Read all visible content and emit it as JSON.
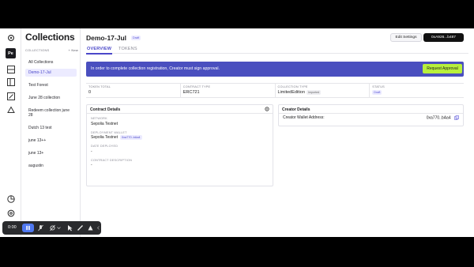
{
  "sidebar": {
    "title": "Collections",
    "section_label": "COLLECTIONS",
    "new_label": "+ New",
    "workspace_badge": "Pe",
    "items": [
      {
        "label": "All Collections"
      },
      {
        "label": "Demo-17-Jul"
      },
      {
        "label": "Test Forest"
      },
      {
        "label": "June 28 collection"
      },
      {
        "label": "Redeem collection june 28"
      },
      {
        "label": "Dutch 13 test"
      },
      {
        "label": "june 13++"
      },
      {
        "label": "june 13+"
      },
      {
        "label": "augustin"
      }
    ]
  },
  "header": {
    "title": "Demo-17-Jul",
    "badge": "Draft",
    "edit_button": "Edit Settings",
    "wallet_button": "0xA926...b487"
  },
  "tabs": [
    {
      "label": "OVERVIEW"
    },
    {
      "label": "TOKENS"
    }
  ],
  "banner": {
    "text": "In order to complete collection registration, Creator must sign approval.",
    "button": "Request Approval"
  },
  "stats": [
    {
      "label": "TOKEN TOTAL",
      "value": "0"
    },
    {
      "label": "CONTRACT TYPE",
      "value": "ERC721"
    },
    {
      "label": "COLLECTION TYPE",
      "value": "LimitedEdition",
      "tag": "Imported"
    },
    {
      "label": "STATUS",
      "value": "Draft"
    }
  ],
  "contract_details": {
    "title": "Contract Details",
    "network_label": "NETWORK",
    "network_value": "Sepolia Testnet",
    "wallet_label": "DEPLOYMENT WALLET",
    "wallet_network": "Sepolia Testnet",
    "wallet_address": "0xa770..bAa4",
    "date_label": "DATE DEPLOYED",
    "date_value": "-",
    "desc_label": "CONTRACT DESCRIPTION",
    "desc_value": "-"
  },
  "creator_details": {
    "title": "Creator Details",
    "address_label": "Creator Wallet Address:",
    "address_value": "0xa770..bAa4"
  },
  "recorder": {
    "time": "0:00"
  },
  "colors": {
    "accent": "#4b48c9",
    "banner": "#4a4fbf",
    "approve": "#b8f03c",
    "recorder_pause": "#4f78f0"
  }
}
